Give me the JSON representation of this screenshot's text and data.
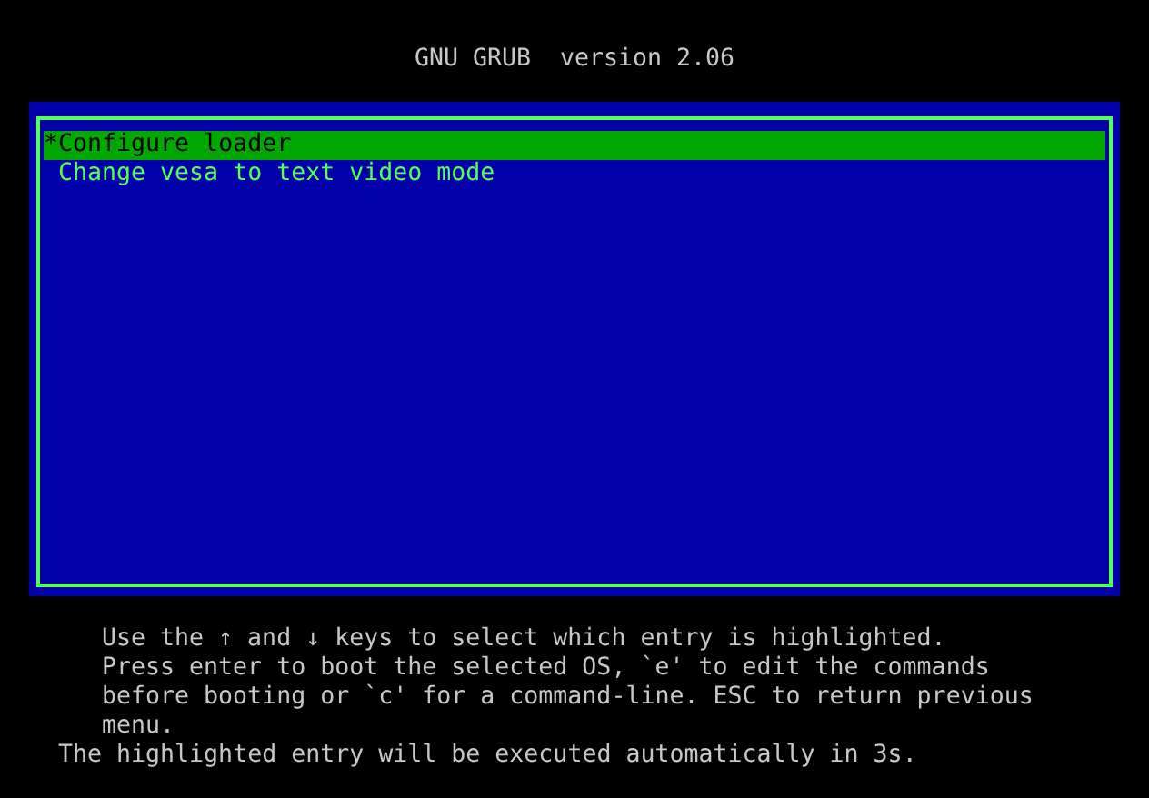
{
  "title": "GNU GRUB  version 2.06",
  "entries": [
    {
      "marker": "*",
      "label": "Configure loader",
      "selected": true
    },
    {
      "label": "Change vesa to text video mode",
      "selected": false
    }
  ],
  "help_lines": [
    "Use the ↑ and ↓ keys to select which entry is highlighted.",
    "Press enter to boot the selected OS, `e' to edit the commands",
    "before booting or `c' for a command-line. ESC to return previous",
    "menu."
  ],
  "countdown": "The highlighted entry will be executed automatically in 3s."
}
